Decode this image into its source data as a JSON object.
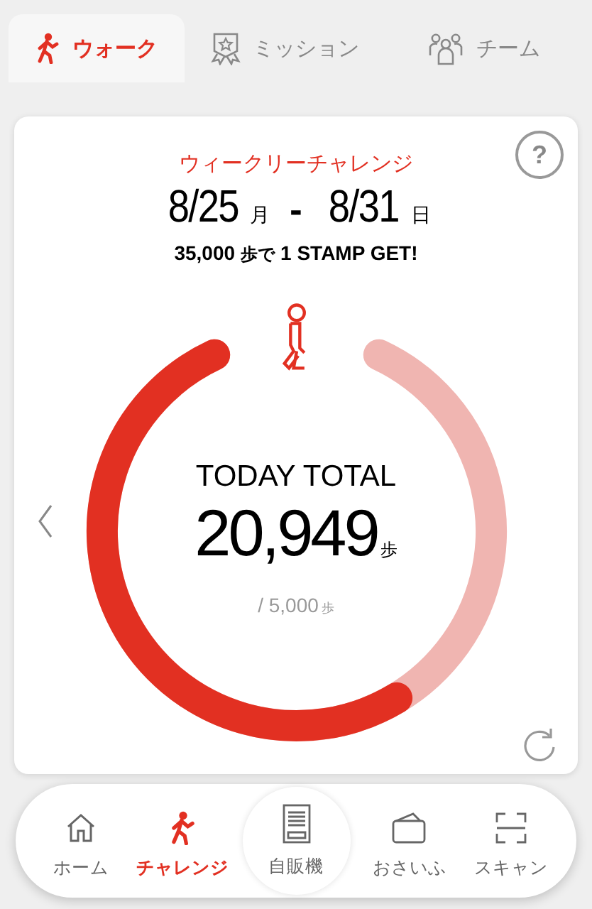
{
  "tabs": [
    {
      "label": "ウォーク",
      "selected": true
    },
    {
      "label": "ミッション",
      "selected": false
    },
    {
      "label": "チーム",
      "selected": false
    }
  ],
  "challenge": {
    "title": "ウィークリーチャレンジ",
    "start_date": "8/25",
    "start_day": "月",
    "separator": "-",
    "end_date": "8/31",
    "end_day": "日",
    "goal_steps": "35,000",
    "goal_unit": "歩で",
    "goal_text": "1 STAMP GET!",
    "help": "?"
  },
  "today": {
    "label": "TODAY TOTAL",
    "steps": "20,949",
    "unit": "歩",
    "target": "/ 5,000",
    "target_unit": "歩"
  },
  "nav": [
    {
      "label": "ホーム",
      "kind": "item",
      "selected": false
    },
    {
      "label": "チャレンジ",
      "kind": "item",
      "selected": true
    },
    {
      "label": "自販機",
      "kind": "center",
      "selected": false
    },
    {
      "label": "おさいふ",
      "kind": "item",
      "selected": false
    },
    {
      "label": "スキャン",
      "kind": "item",
      "selected": false
    }
  ]
}
